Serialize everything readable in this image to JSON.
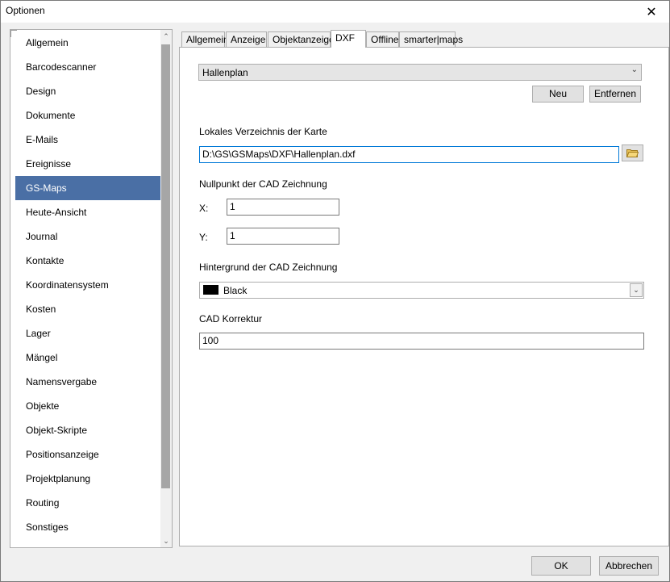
{
  "window": {
    "title": "Optionen",
    "close_glyph": "✕"
  },
  "sidebar": {
    "items": [
      {
        "label": "Allgemein"
      },
      {
        "label": "Barcodescanner"
      },
      {
        "label": "Design"
      },
      {
        "label": "Dokumente"
      },
      {
        "label": "E-Mails"
      },
      {
        "label": "Ereignisse"
      },
      {
        "label": "GS-Maps",
        "selected": true
      },
      {
        "label": "Heute-Ansicht"
      },
      {
        "label": "Journal"
      },
      {
        "label": "Kontakte"
      },
      {
        "label": "Koordinatensystem"
      },
      {
        "label": "Kosten"
      },
      {
        "label": "Lager"
      },
      {
        "label": "Mängel"
      },
      {
        "label": "Namensvergabe"
      },
      {
        "label": "Objekte"
      },
      {
        "label": "Objekt-Skripte"
      },
      {
        "label": "Positionsanzeige"
      },
      {
        "label": "Projektplanung"
      },
      {
        "label": "Routing"
      },
      {
        "label": "Sonstiges"
      }
    ],
    "scroll_up": "⌃",
    "scroll_down": "⌄"
  },
  "tabs": [
    {
      "label": "Allgemein"
    },
    {
      "label": "Anzeige"
    },
    {
      "label": "Objektanzeige"
    },
    {
      "label": "DXF",
      "active": true
    },
    {
      "label": "Offline"
    },
    {
      "label": "smarter|maps"
    }
  ],
  "dxf": {
    "map_select": {
      "value": "Hallenplan",
      "arrow": "⌄"
    },
    "new_button": "Neu",
    "remove_button": "Entfernen",
    "local_dir_label": "Lokales Verzeichnis der Karte",
    "local_dir_value": "D:\\GS\\GSMaps\\DXF\\Hallenplan.dxf",
    "nullpoint_label": "Nullpunkt der CAD Zeichnung",
    "x_label": "X:",
    "x_value": "1",
    "y_label": "Y:",
    "y_value": "1",
    "background_label": "Hintergrund der CAD Zeichnung",
    "background_value": "Black",
    "background_color": "#000000",
    "correction_label": "CAD Korrektur",
    "correction_value": "100"
  },
  "footer": {
    "ok_button": "OK",
    "cancel_button": "Abbrechen"
  },
  "colors": {
    "selection": "#4a6fa5",
    "focus_border": "#0078d7"
  }
}
